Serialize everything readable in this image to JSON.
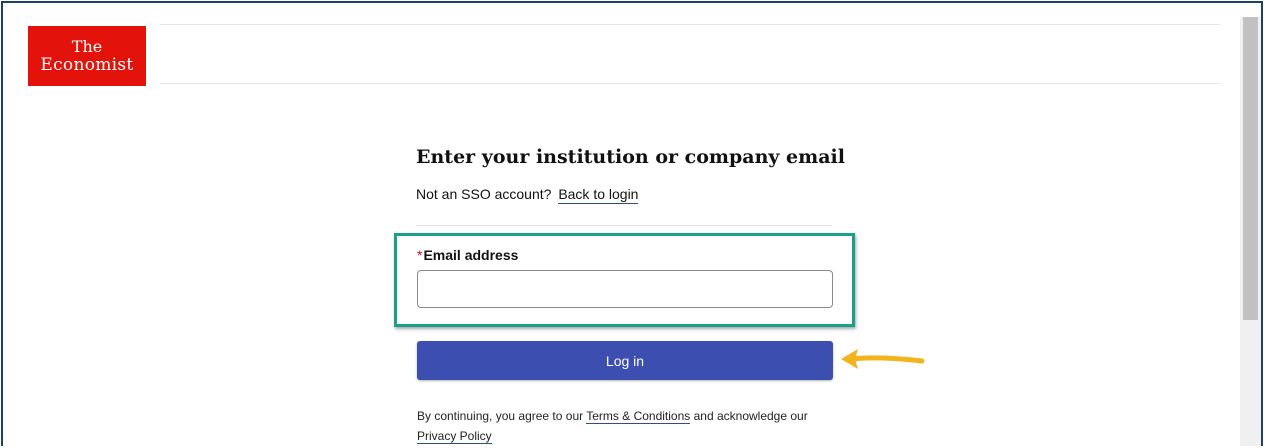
{
  "brand": {
    "logo_line1": "The",
    "logo_line2": "Economist",
    "logo_color": "#e3120b"
  },
  "form": {
    "title": "Enter your institution or company email",
    "sso_prompt": "Not an SSO account?",
    "back_link": "Back to login",
    "required_marker": "*",
    "email_label": "Email address",
    "email_value": "",
    "email_placeholder": "",
    "login_label": "Log in",
    "login_color": "#3c4fb0"
  },
  "legal": {
    "text_before": "By continuing, you agree to our",
    "terms_link": "Terms & Conditions",
    "text_middle": "and acknowledge our",
    "privacy_link": "Privacy Policy"
  },
  "annotations": {
    "highlight_color": "#1aa08a",
    "arrow_color": "#f2b31c"
  }
}
